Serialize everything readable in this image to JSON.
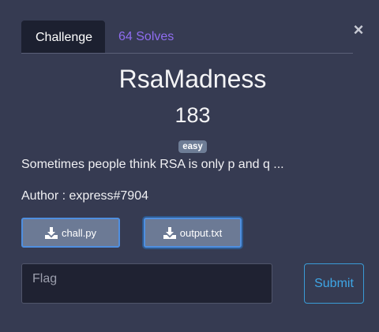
{
  "modal": {
    "close_label": "×",
    "tabs": [
      {
        "label": "Challenge"
      },
      {
        "label": "64 Solves"
      }
    ],
    "challenge": {
      "name": "RsaMadness",
      "points": "183",
      "difficulty": "easy",
      "description": "Sometimes people think RSA is only p and q ...",
      "author": "Author : express#7904"
    },
    "files": [
      {
        "name": "chall.py",
        "icon": "download-icon"
      },
      {
        "name": "output.txt",
        "icon": "download-icon"
      }
    ],
    "flag_form": {
      "placeholder": "Flag",
      "submit_label": "Submit"
    }
  },
  "colors": {
    "background": "#363b52",
    "tab_active_bg": "#1c2030",
    "tab_link": "#8f6df0",
    "badge_bg": "#6e7d96",
    "file_button_bg": "#6c7a95",
    "file_button_border": "#4f8fe0",
    "submit_accent": "#3ea6e6"
  }
}
